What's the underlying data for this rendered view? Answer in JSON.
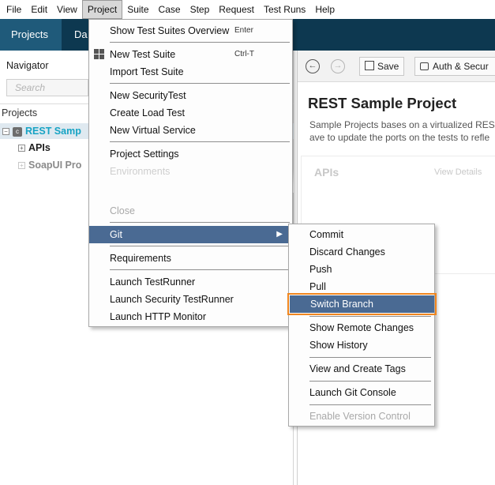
{
  "menubar": {
    "items": [
      "File",
      "Edit",
      "View",
      "Project",
      "Suite",
      "Case",
      "Step",
      "Request",
      "Test Runs",
      "Help"
    ]
  },
  "topnav": {
    "tabs": [
      "Projects",
      "Da"
    ]
  },
  "navigator": {
    "title": "Navigator",
    "search_placeholder": "Search",
    "projects_label": "Projects",
    "tree": [
      {
        "label": "REST Samp",
        "icon_text": "c"
      },
      {
        "label": "APIs"
      },
      {
        "label": "SoapUI Pro"
      }
    ]
  },
  "editor": {
    "save_label": "Save",
    "auth_label": "Auth & Secur",
    "title": "REST Sample Project",
    "desc_line1": "Sample Projects bases on a virtualized REST",
    "desc_line2": "ave to update the ports on the tests to refle",
    "apis_title": "APIs",
    "view_details": "View Details"
  },
  "project_menu": {
    "items": [
      {
        "label": "Show Test Suites Overview",
        "shortcut": "Enter"
      },
      {
        "label": "New Test Suite",
        "shortcut": "Ctrl-T"
      },
      {
        "label": "Import Test Suite"
      },
      {
        "label": "New SecurityTest"
      },
      {
        "label": "Create Load Test"
      },
      {
        "label": "New Virtual Service"
      },
      {
        "label": "Project Settings"
      },
      {
        "label": "Environments"
      },
      {
        "label": "Close"
      },
      {
        "label": "Git"
      },
      {
        "label": "Requirements"
      },
      {
        "label": "Launch TestRunner"
      },
      {
        "label": "Launch Security TestRunner"
      },
      {
        "label": "Launch HTTP Monitor"
      }
    ]
  },
  "git_menu": {
    "items": [
      {
        "label": "Commit"
      },
      {
        "label": "Discard Changes"
      },
      {
        "label": "Push"
      },
      {
        "label": "Pull"
      },
      {
        "label": "Switch Branch"
      },
      {
        "label": "Show Remote Changes"
      },
      {
        "label": "Show History"
      },
      {
        "label": "View and Create Tags"
      },
      {
        "label": "Launch Git Console"
      },
      {
        "label": "Enable Version Control"
      }
    ]
  },
  "colors": {
    "nav_bg": "#0d3850",
    "active_tab": "#1f5a7a",
    "menu_highlight": "#4a6a93",
    "focus_outline": "#f0861f",
    "project_link": "#16a3c4"
  },
  "icons": [
    "back-arrow-icon",
    "forward-arrow-icon",
    "save-icon",
    "lock-icon",
    "grid-icon",
    "submenu-arrow-icon",
    "expand-icon",
    "project-icon"
  ]
}
